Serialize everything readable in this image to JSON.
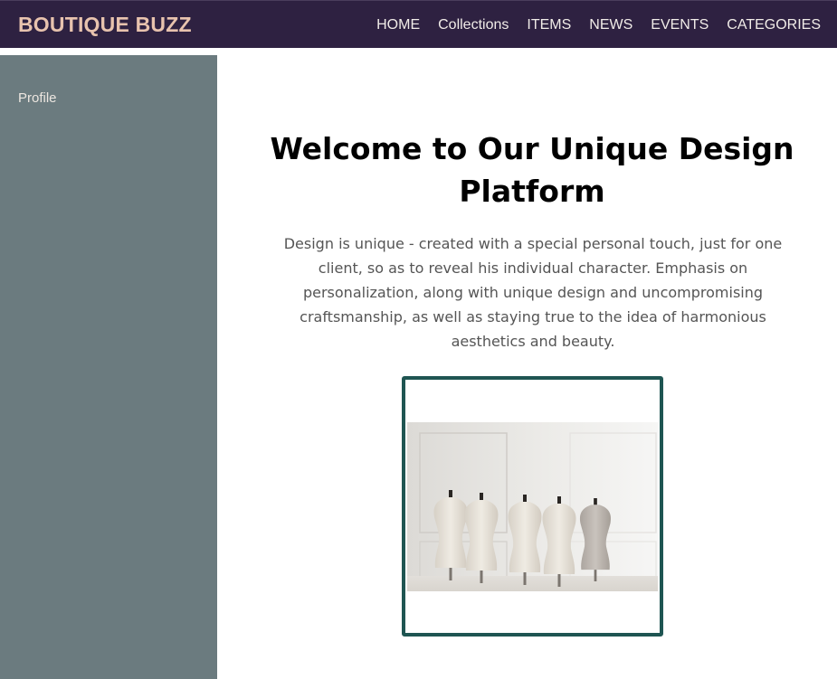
{
  "header": {
    "brand": "BOUTIQUE BUZZ",
    "nav": [
      "HOME",
      "Collections",
      "ITEMS",
      "NEWS",
      "EVENTS",
      "CATEGORIES"
    ]
  },
  "sidebar": {
    "items": [
      {
        "label": "Profile"
      }
    ]
  },
  "main": {
    "title": "Welcome to Our Unique Design Platform",
    "description": "Design is unique - created with a special personal touch, just for one client, so as to reveal his individual character. Emphasis on personalization, along with unique design and uncompromising craftsmanship, as well as staying true to the idea of harmonious aesthetics and beauty.",
    "image": {
      "subject": "mannequin-dress-forms-photo"
    }
  },
  "colors": {
    "header_bg": "#2e2141",
    "brand_text": "#e8c3ae",
    "sidebar_bg": "#6b7b7f",
    "frame_border": "#1f5552"
  }
}
